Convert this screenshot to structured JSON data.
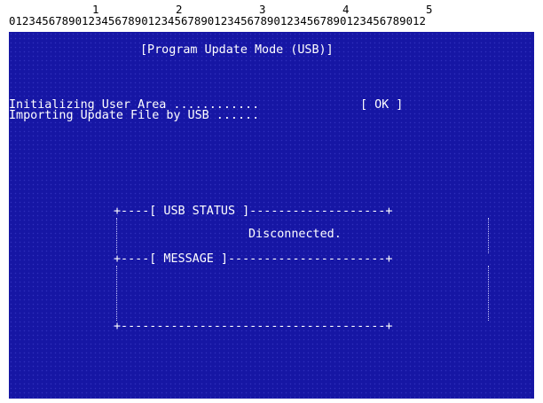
{
  "ruler": {
    "tens": [
      "1",
      "2",
      "3",
      "4",
      "5"
    ],
    "units": "012345678901234567890123456789012345678901234567890123456789012"
  },
  "screen": {
    "title": "[Program Update Mode (USB)]",
    "init_label": "Initializing User Area ............",
    "init_result": "[ OK ]",
    "import_label": "Importing Update File by USB ......",
    "usb_status_border": "+----[ USB STATUS ]-------------------+",
    "usb_status_value": "Disconnected.",
    "message_border": "+----[ MESSAGE ]----------------------+",
    "bottom_border": "+-------------------------------------+"
  },
  "colors": {
    "background": "#1616a4",
    "text": "#ffffff"
  }
}
